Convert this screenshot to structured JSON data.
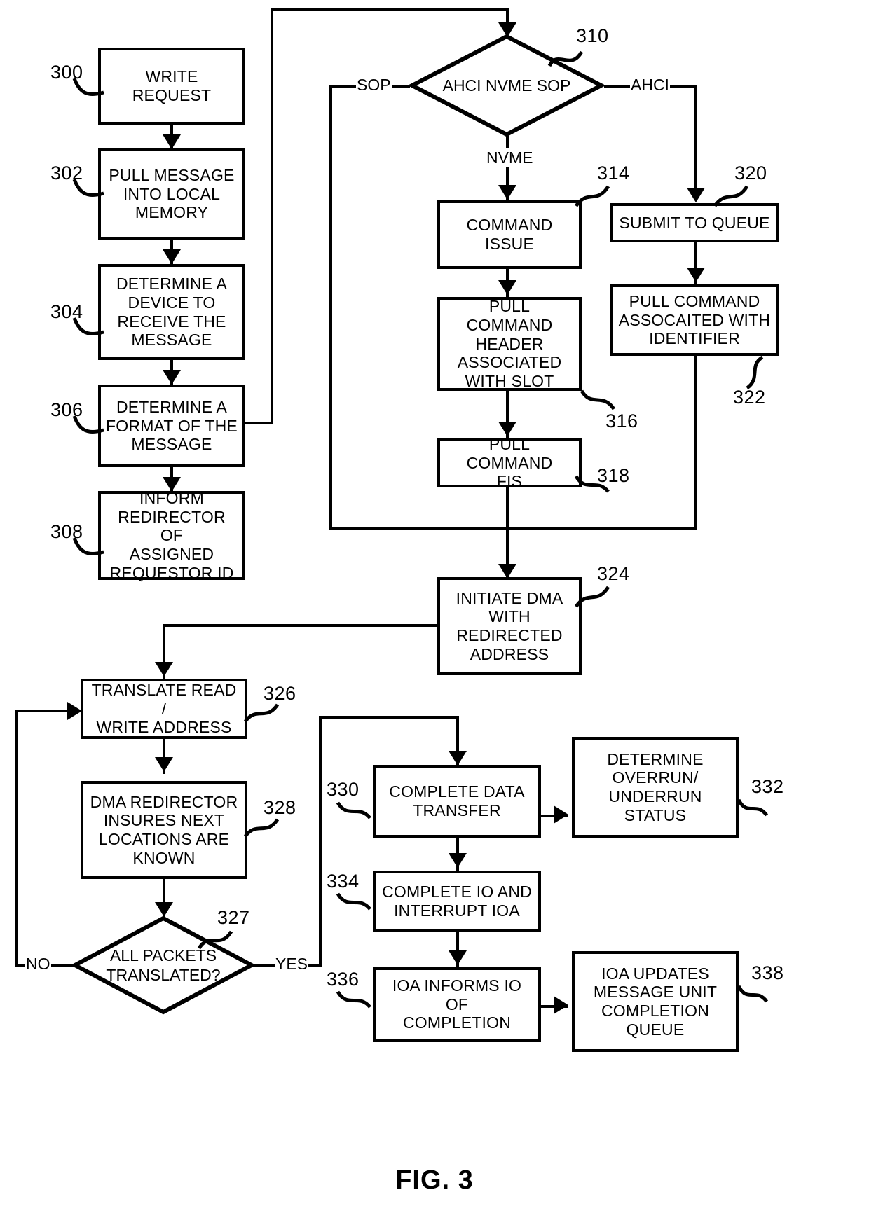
{
  "figure": {
    "caption": "FIG. 3"
  },
  "nodes": [
    {
      "id": "300",
      "ref": "300",
      "text": "WRITE REQUEST"
    },
    {
      "id": "302",
      "ref": "302",
      "text": "PULL MESSAGE INTO LOCAL MEMORY"
    },
    {
      "id": "304",
      "ref": "304",
      "text": "DETERMINE A DEVICE TO RECEIVE THE MESSAGE"
    },
    {
      "id": "306",
      "ref": "306",
      "text": "DETERMINE A FORMAT OF THE MESSAGE"
    },
    {
      "id": "308",
      "ref": "308",
      "text": "INFORM REDIRECTOR OF ASSIGNED REQUESTOR ID"
    },
    {
      "id": "310",
      "ref": "310",
      "text": "AHCI NVME SOP",
      "shape": "decision"
    },
    {
      "id": "314",
      "ref": "314",
      "text": "COMMAND ISSUE"
    },
    {
      "id": "316",
      "ref": "316",
      "text": "PULL COMMAND HEADER ASSOCIATED WITH SLOT"
    },
    {
      "id": "318",
      "ref": "318",
      "text": "PULL COMMAND FIS"
    },
    {
      "id": "320",
      "ref": "320",
      "text": "SUBMIT TO QUEUE"
    },
    {
      "id": "322",
      "ref": "322",
      "text": "PULL COMMAND ASSOCAITED WITH IDENTIFIER"
    },
    {
      "id": "324",
      "ref": "324",
      "text": "INITIATE DMA WITH REDIRECTED ADDRESS"
    },
    {
      "id": "326",
      "ref": "326",
      "text": "TRANSLATE READ / WRITE ADDRESS"
    },
    {
      "id": "328",
      "ref": "328",
      "text": "DMA REDIRECTOR INSURES NEXT LOCATIONS ARE KNOWN"
    },
    {
      "id": "327",
      "ref": "327",
      "text": "ALL PACKETS TRANSLATED?",
      "shape": "decision"
    },
    {
      "id": "330",
      "ref": "330",
      "text": "COMPLETE DATA TRANSFER"
    },
    {
      "id": "332",
      "ref": "332",
      "text": "DETERMINE OVERRUN/ UNDERRUN STATUS"
    },
    {
      "id": "334",
      "ref": "334",
      "text": "COMPLETE IO AND INTERRUPT IOA"
    },
    {
      "id": "336",
      "ref": "336",
      "text": "IOA INFORMS IO OF COMPLETION"
    },
    {
      "id": "338",
      "ref": "338",
      "text": "IOA UPDATES MESSAGE UNIT COMPLETION QUEUE"
    }
  ],
  "node_text": {
    "n300": "WRITE REQUEST",
    "n302_l1": "PULL MESSAGE",
    "n302_l2": "INTO LOCAL",
    "n302_l3": "MEMORY",
    "n304_l1": "DETERMINE A",
    "n304_l2": "DEVICE TO",
    "n304_l3": "RECEIVE THE",
    "n304_l4": "MESSAGE",
    "n306_l1": "DETERMINE A",
    "n306_l2": "FORMAT OF THE",
    "n306_l3": "MESSAGE",
    "n308_l1": "INFORM",
    "n308_l2": "REDIRECTOR OF",
    "n308_l3": "ASSIGNED",
    "n308_l4": "REQUESTOR ID",
    "n310_l1": "AHCI",
    "n310_l2": "NVME",
    "n310_l3": "SOP",
    "n314_l1": "COMMAND",
    "n314_l2": "ISSUE",
    "n316_l1": "PULL COMMAND",
    "n316_l2": "HEADER",
    "n316_l3": "ASSOCIATED",
    "n316_l4": "WITH SLOT",
    "n318_l1": "PULL COMMAND",
    "n318_l2": "FIS",
    "n320": "SUBMIT TO QUEUE",
    "n322_l1": "PULL COMMAND",
    "n322_l2": "ASSOCAITED WITH",
    "n322_l3": "IDENTIFIER",
    "n324_l1": "INITIATE DMA",
    "n324_l2": "WITH",
    "n324_l3": "REDIRECTED",
    "n324_l4": "ADDRESS",
    "n326_l1": "TRANSLATE READ /",
    "n326_l2": "WRITE ADDRESS",
    "n328_l1": "DMA REDIRECTOR",
    "n328_l2": "INSURES NEXT",
    "n328_l3": "LOCATIONS ARE",
    "n328_l4": "KNOWN",
    "n327_l1": "ALL PACKETS",
    "n327_l2": "TRANSLATED?",
    "n330_l1": "COMPLETE DATA",
    "n330_l2": "TRANSFER",
    "n332_l1": "DETERMINE",
    "n332_l2": "OVERRUN/",
    "n332_l3": "UNDERRUN STATUS",
    "n334_l1": "COMPLETE IO AND",
    "n334_l2": "INTERRUPT IOA",
    "n336_l1": "IOA INFORMS IO OF",
    "n336_l2": "COMPLETION",
    "n338_l1": "IOA UPDATES",
    "n338_l2": "MESSAGE UNIT",
    "n338_l3": "COMPLETION",
    "n338_l4": "QUEUE"
  },
  "refs": {
    "r300": "300",
    "r302": "302",
    "r304": "304",
    "r306": "306",
    "r308": "308",
    "r310": "310",
    "r314": "314",
    "r316": "316",
    "r318": "318",
    "r320": "320",
    "r322": "322",
    "r324": "324",
    "r326": "326",
    "r327": "327",
    "r328": "328",
    "r330": "330",
    "r332": "332",
    "r334": "334",
    "r336": "336",
    "r338": "338"
  },
  "edge_labels": {
    "sop": "SOP",
    "ahci": "AHCI",
    "nvme": "NVME",
    "no": "NO",
    "yes": "YES"
  },
  "colors": {
    "ink": "#000000",
    "paper": "#ffffff"
  }
}
